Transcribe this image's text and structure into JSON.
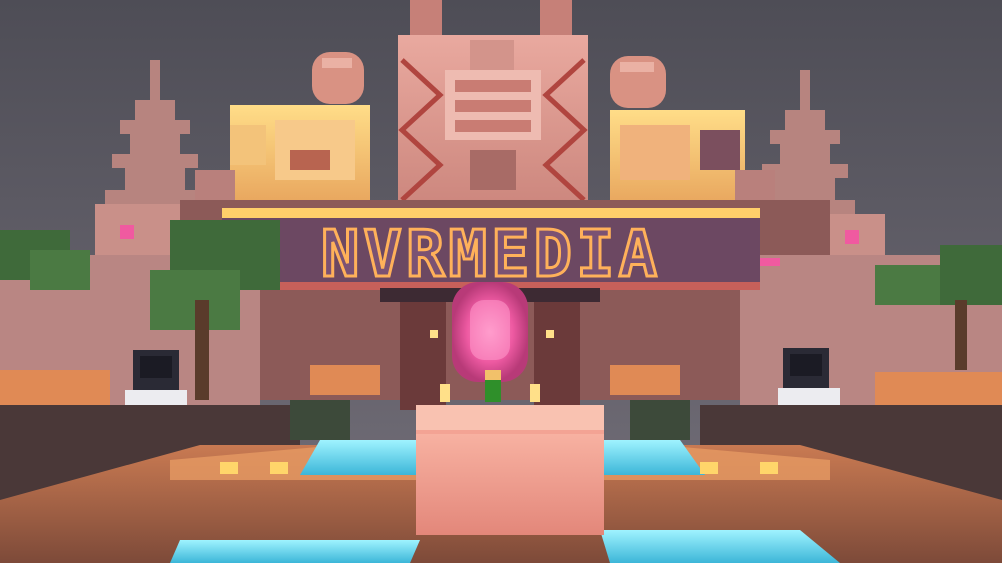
{
  "scene": {
    "type": "minecraft-style voxel hub lobby",
    "palette": {
      "sky_top": "#4f4f58",
      "sky_bottom": "#6e6b72",
      "tower_pink": "#e6a49a",
      "tower_shadow": "#b9756e",
      "accent_red": "#c03b32",
      "portal_pink": "#f06aa8",
      "glow_gold": "#ffd56a",
      "water_cyan": "#6fe6ff",
      "floor_orange": "#e08a55",
      "sign_dark": "#5a3b4d",
      "foliage": "#3f6a3a"
    }
  },
  "sign": {
    "text": "NVRMEDIA",
    "text_color": "#6a4663",
    "outline_color": "#ffb15a"
  },
  "entities": [
    {
      "name": "astronaut-npc-left",
      "kind": "npc"
    },
    {
      "name": "astronaut-npc-right",
      "kind": "npc"
    },
    {
      "name": "player-character",
      "kind": "player"
    }
  ]
}
